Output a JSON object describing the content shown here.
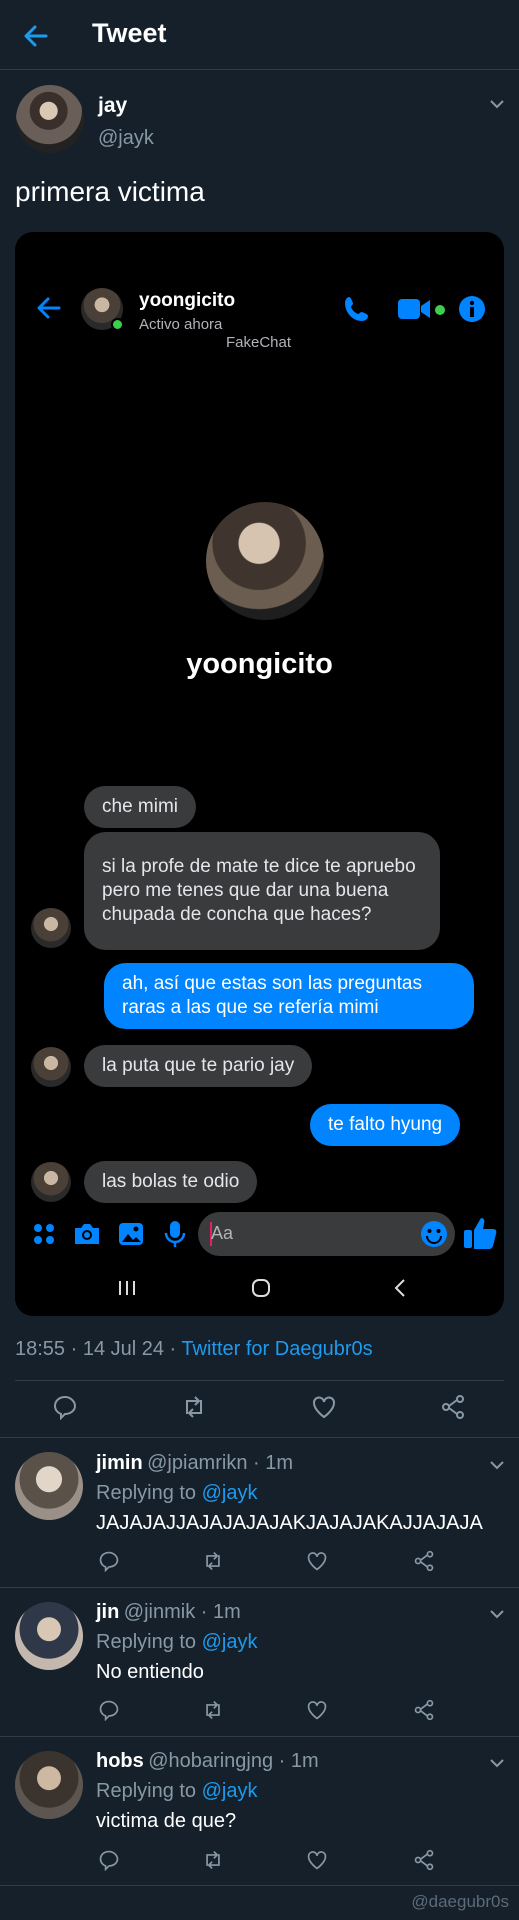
{
  "header": {
    "title": "Tweet"
  },
  "tweet": {
    "author_name": "jay",
    "author_handle": "@jayk",
    "text": "primera victima",
    "meta_time": "18:55 · 14 Jul 24 · ",
    "meta_source": "Twitter for Daegubr0s"
  },
  "chat": {
    "contact_name": "yoongicito",
    "status": "Activo ahora",
    "watermark": "FakeChat",
    "profile_name": "yoongicito",
    "input_placeholder": "Aa",
    "messages": [
      {
        "side": "received",
        "text": "che mimi"
      },
      {
        "side": "received",
        "text": "si la profe de mate te dice te apruebo pero me tenes que dar una buena chupada de concha que haces?"
      },
      {
        "side": "sent",
        "text": "ah, así que estas son las preguntas raras a las que se refería mimi"
      },
      {
        "side": "received",
        "text": "la puta que te pario jay"
      },
      {
        "side": "sent",
        "text": "te falto hyung"
      },
      {
        "side": "received",
        "text": "las bolas te odio"
      }
    ]
  },
  "replies": [
    {
      "name": "jimin",
      "handle": "@jpiamrikn · 1m",
      "replying_label": "Replying to",
      "replying_to": "@jayk",
      "text": "JAJAJAJJAJAJAJAJAKJAJAJAKAJJAJAJA"
    },
    {
      "name": "jin",
      "handle": "@jinmik · 1m",
      "replying_label": "Replying to",
      "replying_to": "@jayk",
      "text": "No entiendo"
    },
    {
      "name": "hobs",
      "handle": "@hobaringjng · 1m",
      "replying_label": "Replying to",
      "replying_to": "@jayk",
      "text": "victima de que?"
    }
  ],
  "footer": {
    "watermark": "@daegubr0s"
  },
  "colors": {
    "background": "#15202b",
    "accent": "#1d9bf0",
    "messenger_blue": "#0084ff",
    "bubble_gray": "#3a3b3c",
    "online_green": "#3cd04a"
  }
}
